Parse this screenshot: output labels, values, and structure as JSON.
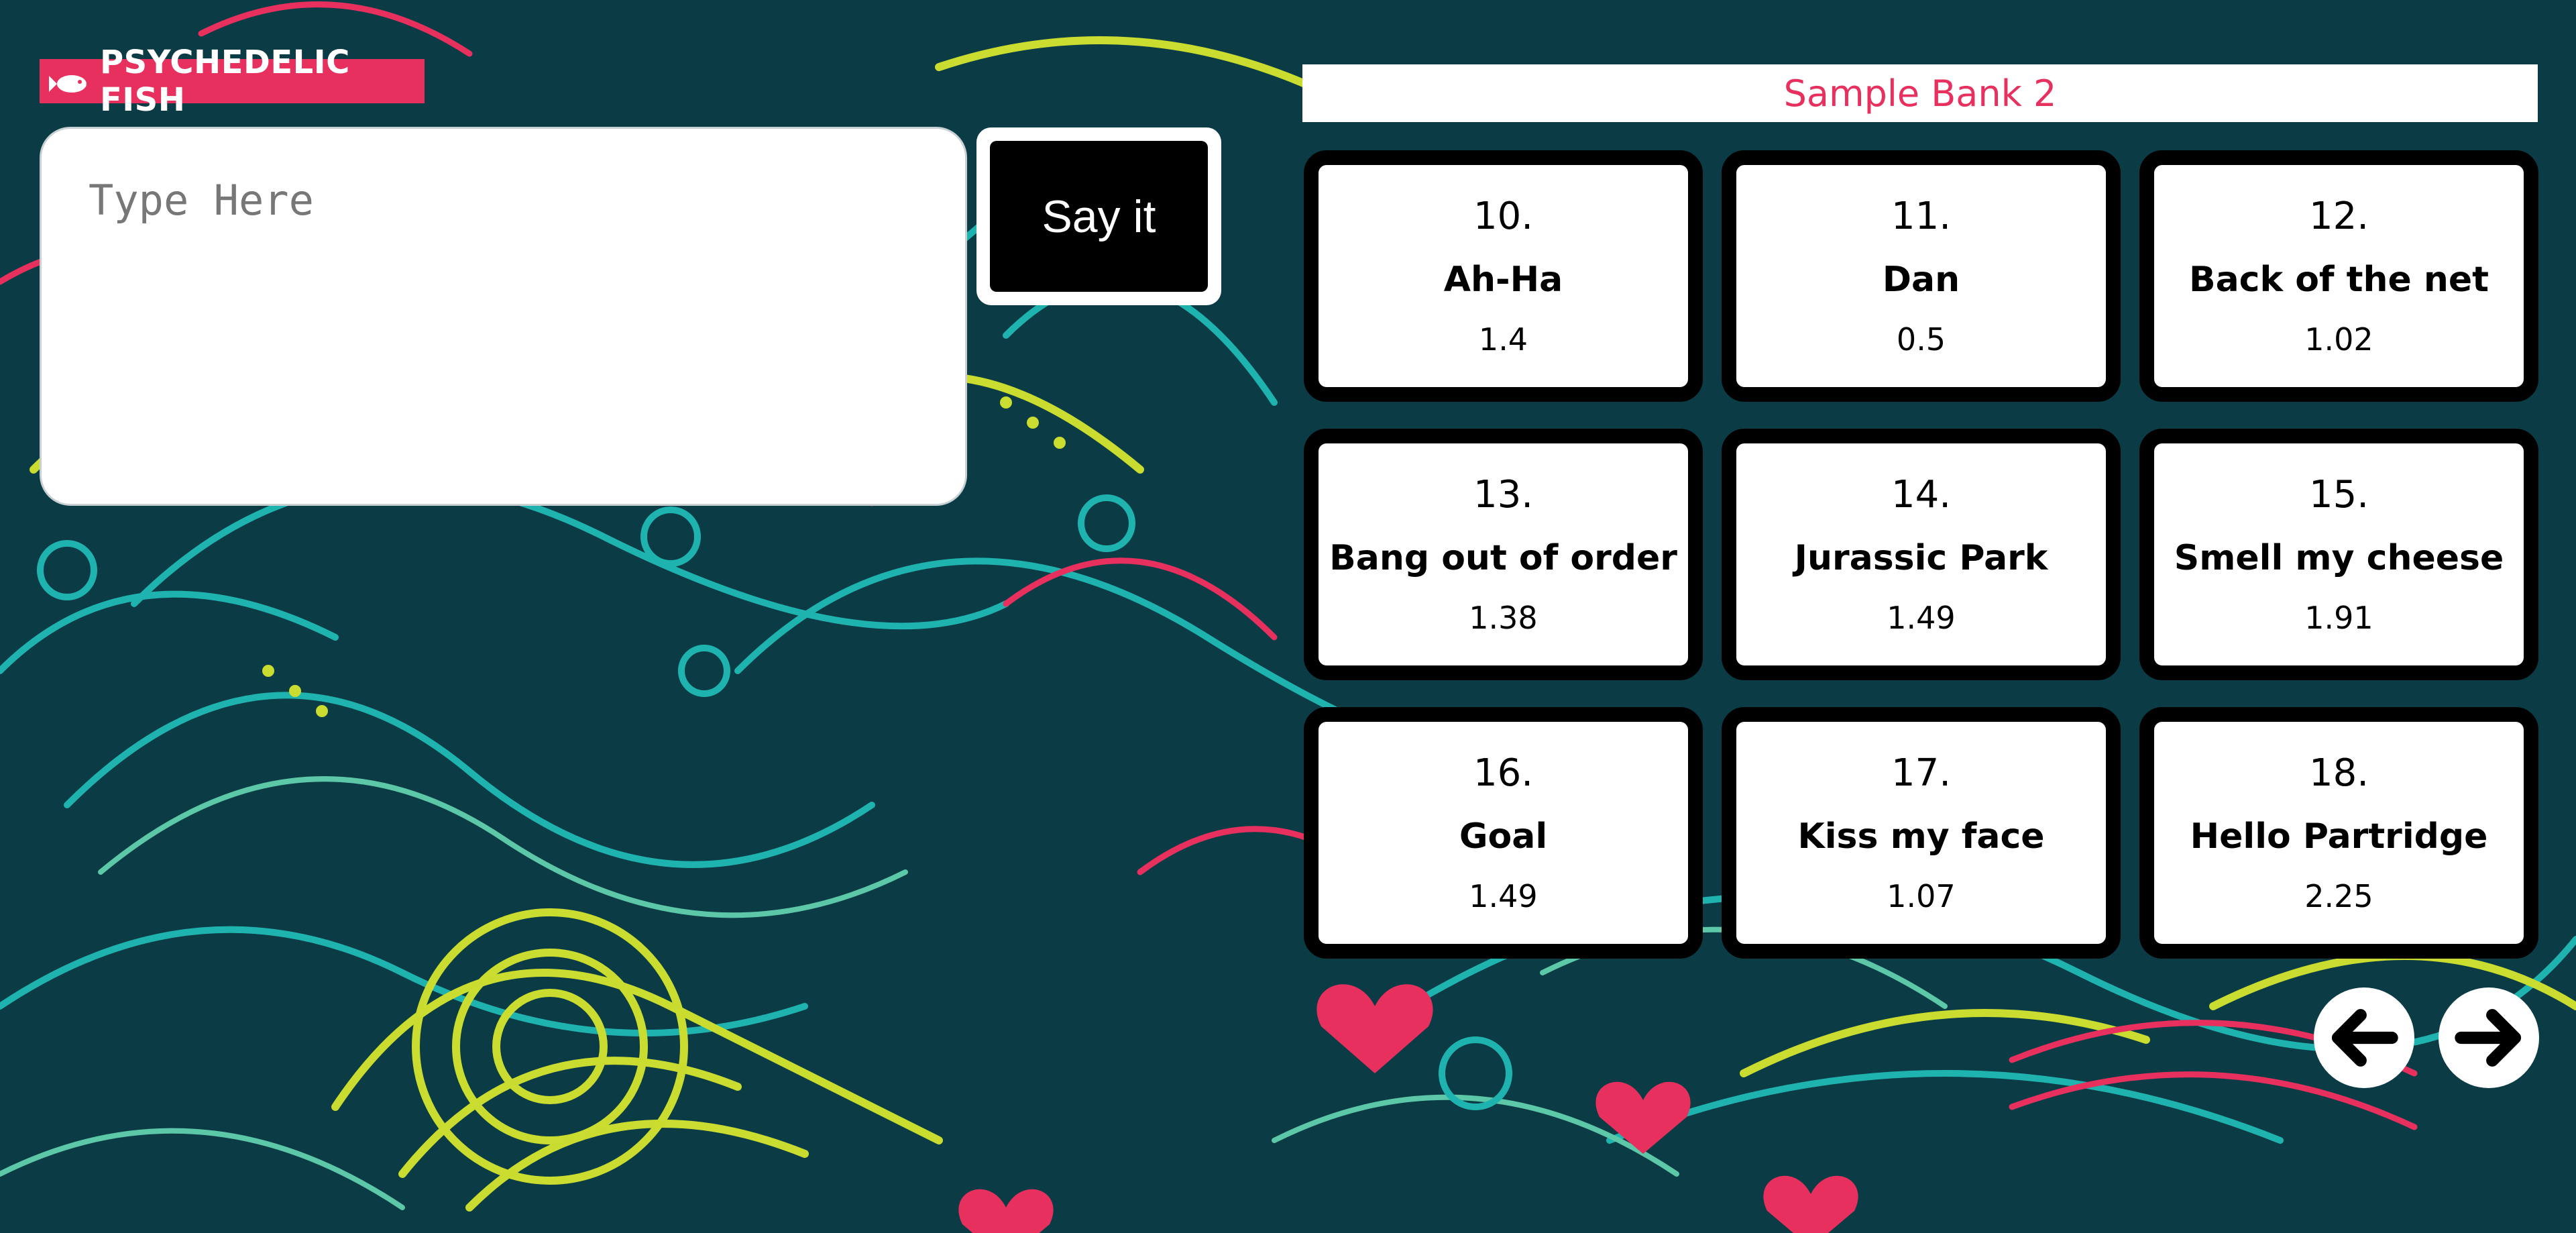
{
  "brand": {
    "name": "PSYCHEDELIC FISH",
    "icon": "fish-icon"
  },
  "input": {
    "placeholder": "Type Here",
    "value": ""
  },
  "say_button": {
    "label": "Say it"
  },
  "bank": {
    "title": "Sample Bank 2",
    "samples": [
      {
        "number": "10.",
        "name": "Ah-Ha",
        "duration": "1.4"
      },
      {
        "number": "11.",
        "name": "Dan",
        "duration": "0.5"
      },
      {
        "number": "12.",
        "name": "Back of the net",
        "duration": "1.02"
      },
      {
        "number": "13.",
        "name": "Bang out of order",
        "duration": "1.38"
      },
      {
        "number": "14.",
        "name": "Jurassic Park",
        "duration": "1.49"
      },
      {
        "number": "15.",
        "name": "Smell my cheese",
        "duration": "1.91"
      },
      {
        "number": "16.",
        "name": "Goal",
        "duration": "1.49"
      },
      {
        "number": "17.",
        "name": "Kiss my face",
        "duration": "1.07"
      },
      {
        "number": "18.",
        "name": "Hello Partridge",
        "duration": "2.25"
      }
    ]
  },
  "navigation": {
    "prev_icon": "arrow-left-icon",
    "next_icon": "arrow-right-icon"
  },
  "colors": {
    "background": "#0b3b45",
    "accent": "#e8305f",
    "teal": "#1fb3b0",
    "lime": "#c9dc2f",
    "mint": "#5cc8a8"
  }
}
